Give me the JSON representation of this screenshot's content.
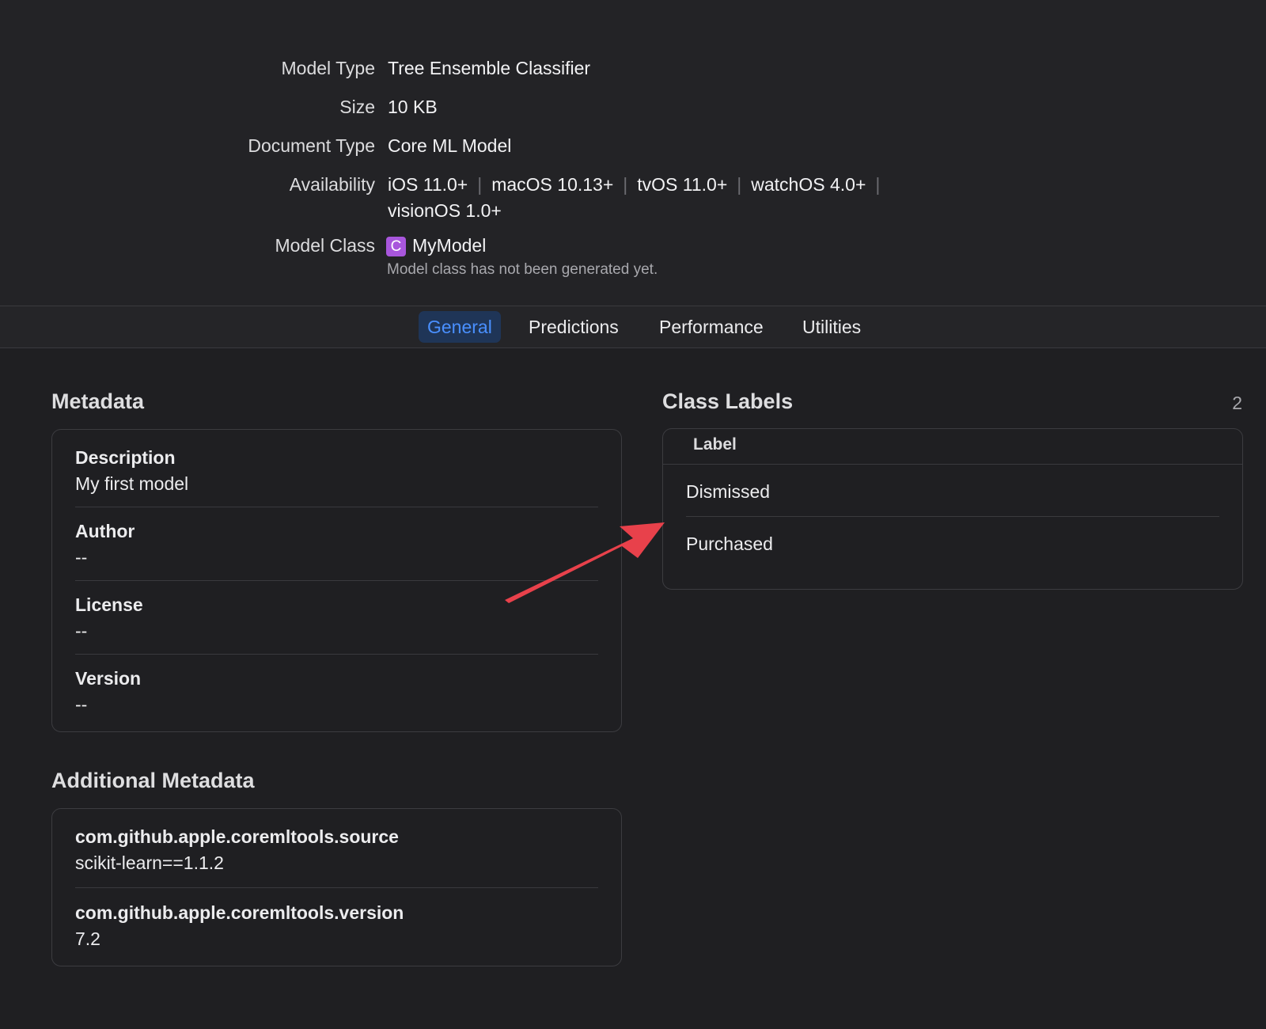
{
  "info": {
    "model_type": {
      "label": "Model Type",
      "value": "Tree Ensemble Classifier"
    },
    "size": {
      "label": "Size",
      "value": "10 KB"
    },
    "document_type": {
      "label": "Document Type",
      "value": "Core ML Model"
    },
    "availability": {
      "label": "Availability",
      "platforms": [
        "iOS 11.0+",
        "macOS 10.13+",
        "tvOS 11.0+",
        "watchOS 4.0+",
        "visionOS 1.0+"
      ],
      "separator": "|"
    },
    "model_class": {
      "label": "Model Class",
      "badge": "C",
      "value": "MyModel",
      "note": "Model class has not been generated yet."
    }
  },
  "tabs": [
    {
      "label": "General",
      "active": true
    },
    {
      "label": "Predictions",
      "active": false
    },
    {
      "label": "Performance",
      "active": false
    },
    {
      "label": "Utilities",
      "active": false
    }
  ],
  "metadata": {
    "title": "Metadata",
    "fields": [
      {
        "key": "Description",
        "value": "My first model"
      },
      {
        "key": "Author",
        "value": "--"
      },
      {
        "key": "License",
        "value": "--"
      },
      {
        "key": "Version",
        "value": "--"
      }
    ]
  },
  "additional_metadata": {
    "title": "Additional Metadata",
    "fields": [
      {
        "key": "com.github.apple.coremltools.source",
        "value": "scikit-learn==1.1.2"
      },
      {
        "key": "com.github.apple.coremltools.version",
        "value": "7.2"
      }
    ]
  },
  "class_labels": {
    "title": "Class Labels",
    "count": "2",
    "column_header": "Label",
    "items": [
      "Dismissed",
      "Purchased"
    ]
  },
  "colors": {
    "background": "#1f1f22",
    "accent": "#4a90ff",
    "class_badge": "#a856dc",
    "annotation_arrow": "#e8414b"
  }
}
